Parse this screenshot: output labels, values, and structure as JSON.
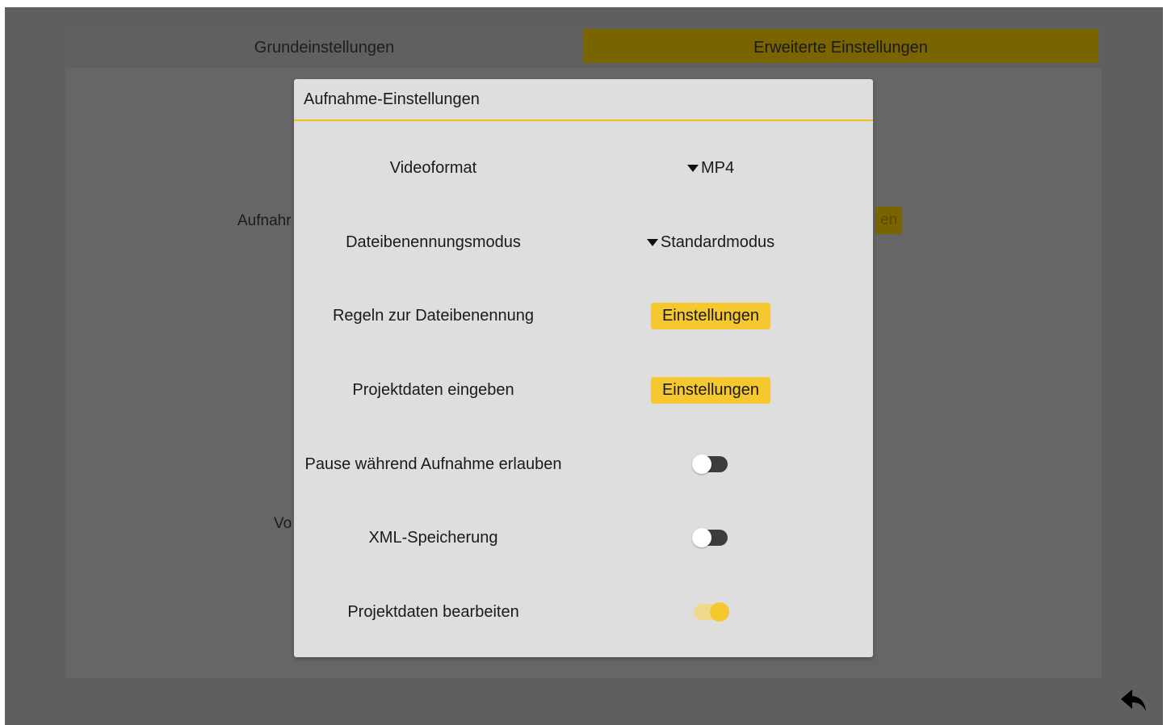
{
  "tabs": {
    "basic": "Grundeinstellungen",
    "advanced": "Erweiterte Einstellungen"
  },
  "background": {
    "label_recording": "Aufnahr",
    "label_vol": "Vo",
    "chip_partial": "en"
  },
  "dialog": {
    "title": "Aufnahme-Einstellungen",
    "rows": [
      {
        "label": "Videoformat",
        "type": "dropdown",
        "value": "MP4"
      },
      {
        "label": "Dateibenennungsmodus",
        "type": "dropdown",
        "value": "Standardmodus"
      },
      {
        "label": "Regeln zur Dateibenennung",
        "type": "button",
        "value": "Einstellungen"
      },
      {
        "label": "Projektdaten eingeben",
        "type": "button",
        "value": "Einstellungen"
      },
      {
        "label": "Pause während Aufnahme erlauben",
        "type": "toggle",
        "on": false
      },
      {
        "label": "XML-Speicherung",
        "type": "toggle",
        "on": false
      },
      {
        "label": "Projektdaten bearbeiten",
        "type": "toggle",
        "on": true
      }
    ]
  },
  "colors": {
    "accent": "#f6c830",
    "overlay_bg": "#5f5f5f",
    "dialog_bg": "#dedede"
  },
  "icons": {
    "back": "back-arrow-icon",
    "dropdown": "caret-down-icon"
  }
}
